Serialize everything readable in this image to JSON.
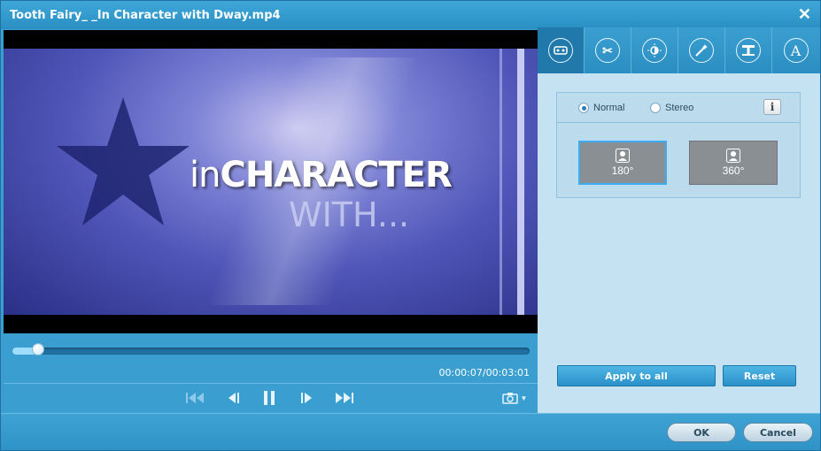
{
  "window": {
    "title": "Tooth Fairy_ _In Character with Dway.mp4"
  },
  "video": {
    "text_small": "in",
    "text_big": "CHARACTER",
    "text_line2": "WITH..."
  },
  "player": {
    "time": "00:00:07/00:03:01",
    "progress": 0.04
  },
  "toolbar": {
    "tools": [
      {
        "icon": "3d-icon",
        "active": true
      },
      {
        "icon": "scissors-icon"
      },
      {
        "icon": "effect-icon"
      },
      {
        "icon": "magic-wand-icon"
      },
      {
        "icon": "watermark-icon"
      },
      {
        "icon": "text-icon"
      }
    ]
  },
  "panel": {
    "radio_normal": "Normal",
    "radio_stereo": "Stereo",
    "selected_mode": "Normal",
    "info_label": "i",
    "mode_180": "180°",
    "mode_360": "360°",
    "apply_to_all": "Apply to all",
    "reset": "Reset"
  },
  "footer": {
    "ok": "OK",
    "cancel": "Cancel"
  }
}
